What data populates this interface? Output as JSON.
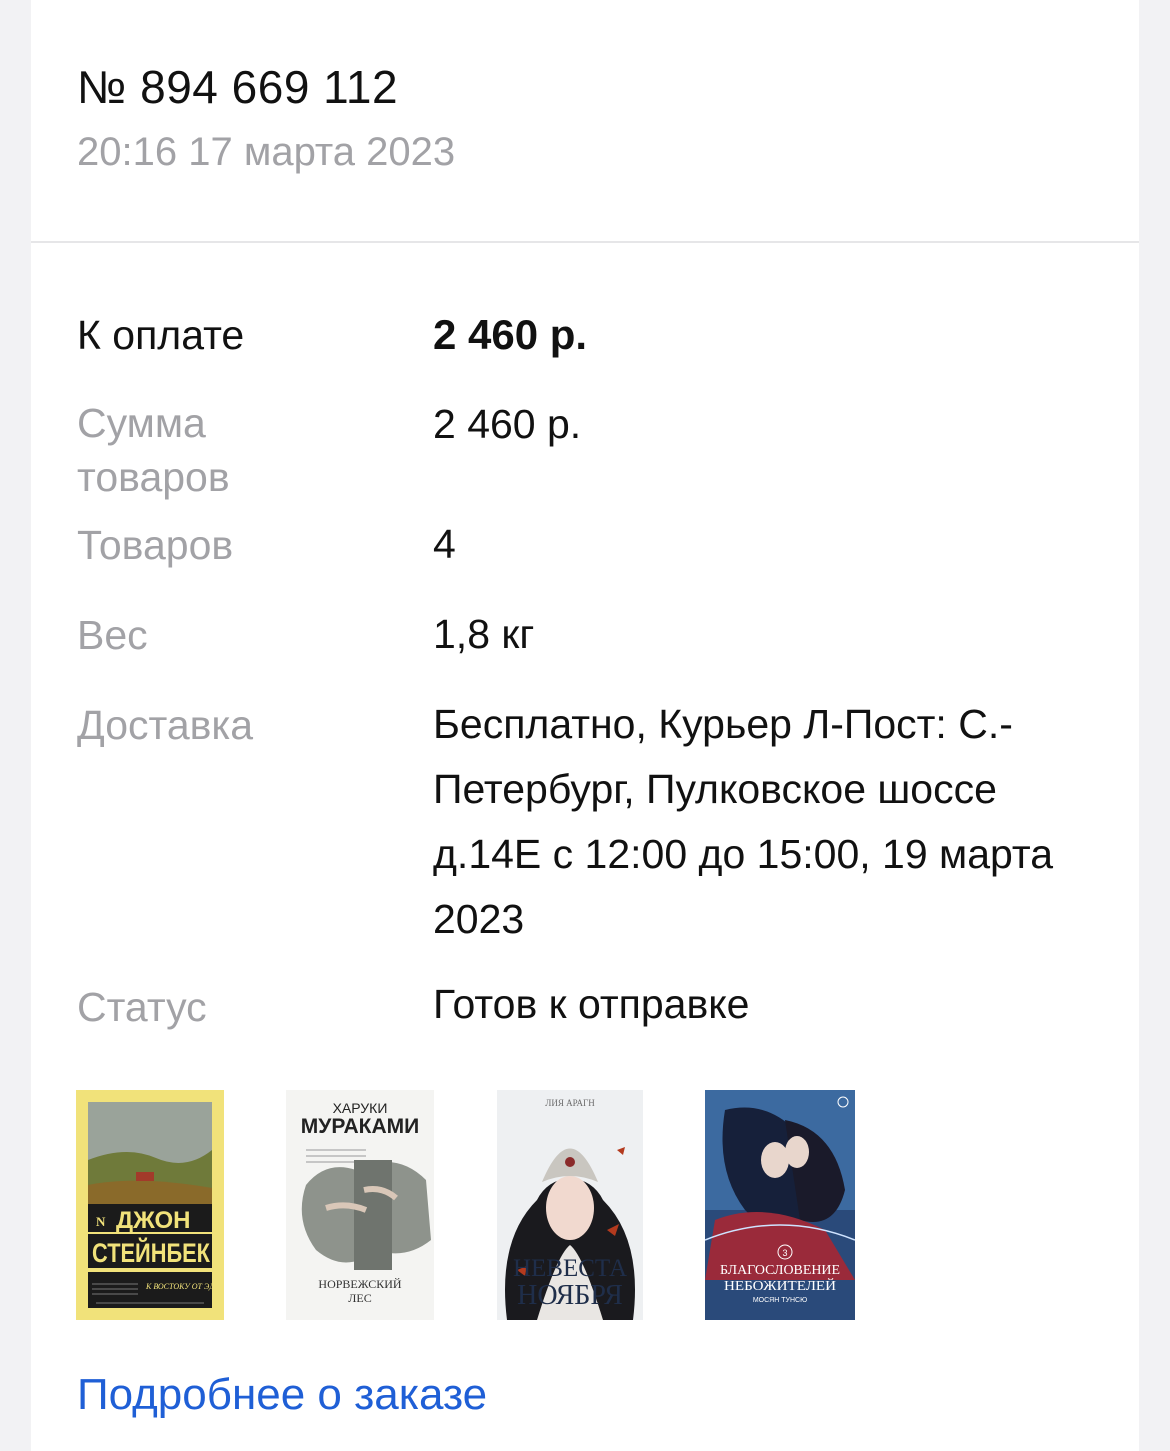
{
  "order": {
    "number": "№ 894 669 112",
    "date": "20:16 17 марта 2023"
  },
  "summary": {
    "to_pay_label": "К оплате",
    "to_pay_value": "2 460 р.",
    "items_sum_label": "Сумма товаров",
    "items_sum_value": "2 460 р.",
    "items_count_label": "Товаров",
    "items_count_value": "4",
    "weight_label": "Вес",
    "weight_value": "1,8 кг",
    "delivery_label": "Доставка",
    "delivery_value": "Бесплатно, Курьер Л-Пост: С.-Петербург, Пулковское шоссе д.14Е с 12:00 до 15:00, 19 марта 2023",
    "status_label": "Статус",
    "status_value": "Готов к отправке"
  },
  "books": [
    {
      "cover_texts": [
        "ДЖОН",
        "СТЕЙНБЕК",
        "К ВОСТОКУ ОТ ЭДЕМА"
      ],
      "colors": {
        "frame": "#f1e27a",
        "sky": "#9aa39a",
        "field": "#6f7a3a",
        "band": "#1b1b1b"
      }
    },
    {
      "cover_texts": [
        "ХАРУКИ",
        "МУРАКАМИ",
        "НОРВЕЖСКИЙ",
        "ЛЕС"
      ],
      "colors": {
        "bg": "#f4f4f2",
        "photo": "#8e938c"
      }
    },
    {
      "cover_texts": [
        "ЛИЯ АРАГН",
        "НЕВЕСТА",
        "НОЯБРЯ"
      ],
      "colors": {
        "bg": "#eef0f2",
        "hair": "#1a1a1e",
        "accent": "#b33a1e"
      }
    },
    {
      "cover_texts": [
        "БЛАГОСЛОВЕНИЕ",
        "НЕБОЖИТЕЛЕЙ",
        "МОСЯН ТУНСЮ"
      ],
      "colors": {
        "bg": "#2a4a7a",
        "dark": "#16203a",
        "accent": "#9a2a3a"
      }
    }
  ],
  "details_link": "Подробнее о заказе",
  "colors": {
    "link": "#1f5fd6",
    "muted": "#a2a2a6",
    "text": "#111111"
  }
}
